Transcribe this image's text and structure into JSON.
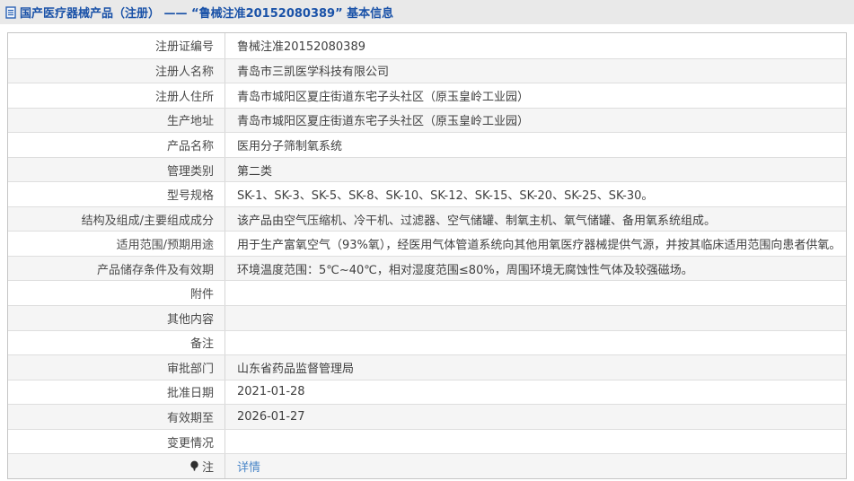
{
  "colors": {
    "title_blue": "#1a52a8",
    "link_blue": "#4a86c8",
    "stripe_gray": "#f5f5f5",
    "band_gray": "#e9e9e9"
  },
  "header": {
    "title": "国产医疗器械产品（注册） —— “鲁械注准20152080389” 基本信息",
    "icon": "document-icon"
  },
  "table": {
    "rows": [
      {
        "label": "注册证编号",
        "value": "鲁械注准20152080389"
      },
      {
        "label": "注册人名称",
        "value": "青岛市三凯医学科技有限公司"
      },
      {
        "label": "注册人住所",
        "value": "青岛市城阳区夏庄街道东宅子头社区（原玉皇岭工业园）"
      },
      {
        "label": "生产地址",
        "value": "青岛市城阳区夏庄街道东宅子头社区（原玉皇岭工业园）"
      },
      {
        "label": "产品名称",
        "value": "医用分子筛制氧系统"
      },
      {
        "label": "管理类别",
        "value": "第二类"
      },
      {
        "label": "型号规格",
        "value": "SK-1、SK-3、SK-5、SK-8、SK-10、SK-12、SK-15、SK-20、SK-25、SK-30。"
      },
      {
        "label": "结构及组成/主要组成成分",
        "value": "该产品由空气压缩机、冷干机、过滤器、空气储罐、制氧主机、氧气储罐、备用氧系统组成。"
      },
      {
        "label": "适用范围/预期用途",
        "value": "用于生产富氧空气（93%氧），经医用气体管道系统向其他用氧医疗器械提供气源，并按其临床适用范围向患者供氧。"
      },
      {
        "label": "产品储存条件及有效期",
        "value": "环境温度范围：5℃~40℃，相对湿度范围≤80%，周围环境无腐蚀性气体及较强磁场。"
      },
      {
        "label": "附件",
        "value": ""
      },
      {
        "label": "其他内容",
        "value": ""
      },
      {
        "label": "备注",
        "value": ""
      },
      {
        "label": "审批部门",
        "value": "山东省药品监督管理局"
      },
      {
        "label": "批准日期",
        "value": "2021-01-28"
      },
      {
        "label": "有效期至",
        "value": "2026-01-27"
      },
      {
        "label": "变更情况",
        "value": ""
      },
      {
        "label": "注",
        "icon": "note-bulb-icon",
        "link": "详情"
      }
    ]
  }
}
